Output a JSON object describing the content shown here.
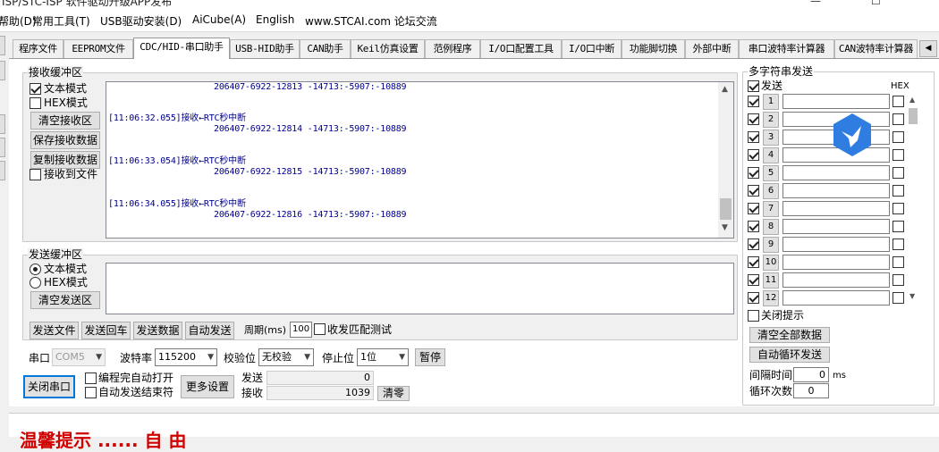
{
  "window": {
    "title": "ISP/STC-ISP 软件驱动升级APP发布",
    "minimize": "—",
    "maximize": "☐"
  },
  "menu": [
    {
      "label": "帮助(D)"
    },
    {
      "label": "常用工具(T)"
    },
    {
      "label": "USB驱动安装(D)"
    },
    {
      "label": "AiCube(A)"
    },
    {
      "label": "English"
    },
    {
      "label": "www.STCAI.com 论坛交流"
    }
  ],
  "tabs": [
    "程序文件",
    "EEPROM文件",
    "CDC/HID-串口助手",
    "USB-HID助手",
    "CAN助手",
    "Keil仿真设置",
    "范例程序",
    "I/O口配置工具",
    "I/O口中断",
    "功能脚切换",
    "外部中断",
    "串口波特率计算器",
    "CAN波特率计算器"
  ],
  "receive": {
    "group_label": "接收缓冲区",
    "text_mode": "文本模式",
    "hex_mode": "HEX模式",
    "clear_btn": "清空接收区",
    "save_btn": "保存接收数据",
    "copy_btn": "复制接收数据",
    "to_file": "接收到文件",
    "lines": [
      {
        "ts": "",
        "data": "206407-6922-12813 -14713:-5907:-10889"
      },
      {
        "ts": "[11:06:32.055]接收←RTC秒中断",
        "data": "206407-6922-12814 -14713:-5907:-10889"
      },
      {
        "ts": "[11:06:33.054]接收←RTC秒中断",
        "data": "206407-6922-12815 -14713:-5907:-10889"
      },
      {
        "ts": "[11:06:34.055]接收←RTC秒中断",
        "data": "206407-6922-12816 -14713:-5907:-10889"
      }
    ]
  },
  "send": {
    "group_label": "发送缓冲区",
    "text_mode": "文本模式",
    "hex_mode": "HEX模式",
    "clear_btn": "清空发送区",
    "send_file": "发送文件",
    "send_enter": "发送回车",
    "send_data": "发送数据",
    "auto_send": "自动发送",
    "period_label": "周期(ms)",
    "period_value": "100",
    "match_test": "收发匹配测试"
  },
  "serial": {
    "port_label": "串口",
    "port_value": "COM5",
    "baud_label": "波特率",
    "baud_value": "115200",
    "parity_label": "校验位",
    "parity_value": "无校验",
    "stop_label": "停止位",
    "stop_value": "1位",
    "pause_btn": "暂停",
    "close_btn": "关闭串口",
    "auto_open": "编程完自动打开",
    "auto_end": "自动发送结束符",
    "more_btn": "更多设置",
    "tx_label": "发送",
    "tx_count": "0",
    "rx_label": "接收",
    "rx_count": "1039",
    "clear_count": "清零"
  },
  "multi": {
    "group_label": "多字符串发送",
    "send_col": "发送",
    "hex_col": "HEX",
    "rows": [
      "1",
      "2",
      "3",
      "4",
      "5",
      "6",
      "7",
      "8",
      "9",
      "10",
      "11",
      "12"
    ],
    "close_tip": "关闭提示",
    "clear_all": "清空全部数据",
    "auto_loop": "自动循环发送",
    "interval_label": "间隔时间",
    "interval_value": "0",
    "interval_unit": "ms",
    "loop_label": "循环次数",
    "loop_value": "0"
  },
  "bottom": {
    "text": "温馨提示 ...... 自 由"
  },
  "colors": {
    "rx_text": "#00008b",
    "badge": "#2f7de1",
    "bottom_text": "#d00000"
  }
}
